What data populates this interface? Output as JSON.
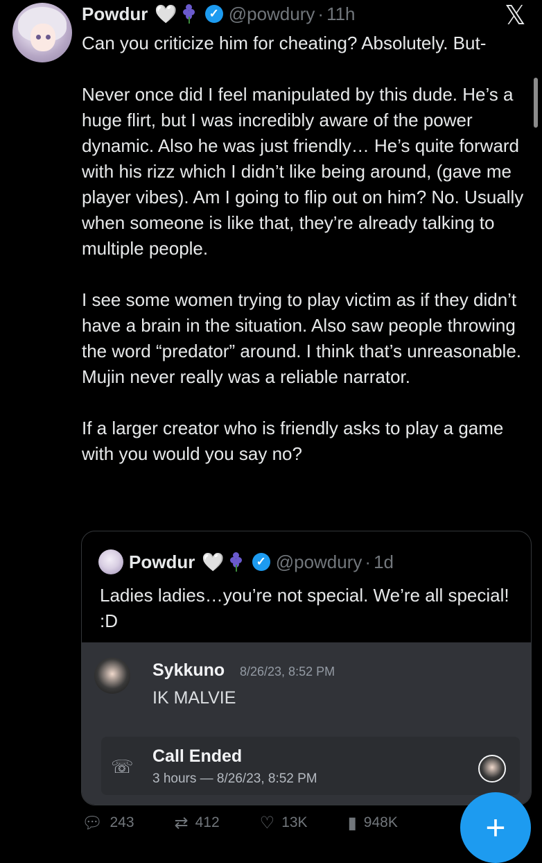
{
  "tweet": {
    "author_name": "Powdur",
    "heart_emoji": "🤍",
    "handle": "@powdury",
    "separator": "·",
    "time": "11h",
    "paragraphs": [
      "Can you criticize him for cheating? Absolutely. But-",
      "Never once did I feel manipulated by this dude. He’s a huge flirt, but I was incredibly aware of the power dynamic. Also he was just friendly… He’s quite forward with his rizz which I didn’t like being around, (gave me player vibes). Am I going to flip out on him? No. Usually when someone is like that, they’re already talking to multiple people.",
      "I see some women trying to play victim as if they didn’t have a brain in the situation. Also saw people throwing the word “predator” around. I think that’s unreasonable. Mujin never really was a reliable narrator.",
      "If a larger creator who is friendly asks to play a game with you would you say no?"
    ]
  },
  "quote": {
    "author_name": "Powdur",
    "heart_emoji": "🤍",
    "handle": "@powdury",
    "separator": "·",
    "time": "1d",
    "text": "Ladies ladies…you’re not special. We’re all special! :D",
    "discord": {
      "username": "Sykkuno",
      "timestamp": "8/26/23, 8:52 PM",
      "message": "IK MALVIE",
      "call_title": "Call Ended",
      "call_subtitle": "3 hours — 8/26/23, 8:52 PM"
    }
  },
  "actions": {
    "replies": "243",
    "reposts": "412",
    "likes": "13K",
    "views": "948K"
  },
  "icons": {
    "close": "x-logo-icon",
    "reply": "reply-icon",
    "repost": "repost-icon",
    "like": "heart-icon",
    "views": "views-icon",
    "compose": "plus-icon",
    "call": "phone-icon"
  },
  "colors": {
    "background": "#000000",
    "text": "#e7e9ea",
    "muted": "#71767b",
    "accent": "#1d9bf0",
    "discord_bg": "#313338"
  }
}
